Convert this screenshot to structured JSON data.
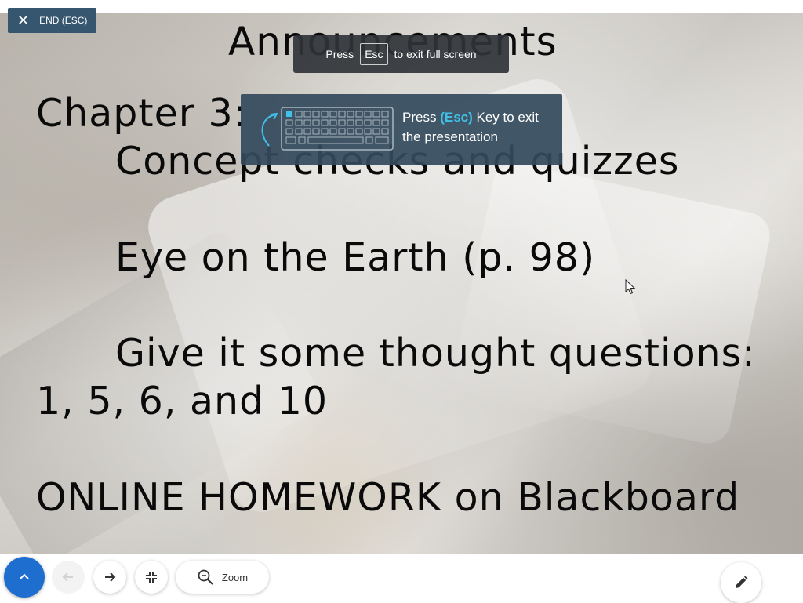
{
  "slide": {
    "title": "Announcements",
    "lines": [
      "Chapter 3:",
      "Concept checks and quizzes",
      "Eye on the Earth (p. 98)",
      "Give it some thought questions:",
      "1, 5, 6, and 10",
      "ONLINE HOMEWORK on Blackboard"
    ]
  },
  "end_button": {
    "label": "END (ESC)",
    "icon": "close-icon"
  },
  "fullscreen_toast": {
    "before": "Press",
    "key": "Esc",
    "after": "to exit full screen"
  },
  "esc_hint": {
    "before": "Press",
    "key": "(Esc)",
    "after": "Key to exit the presentation",
    "icon": "keyboard-icon"
  },
  "toolbar": {
    "toggle_icon": "chevron-up-icon",
    "prev_icon": "arrow-left-icon",
    "next_icon": "arrow-right-icon",
    "exit_fullscreen_icon": "exit-fullscreen-icon",
    "zoom_label": "Zoom",
    "zoom_icon": "zoom-out-icon",
    "pen_icon": "pencil-icon"
  },
  "colors": {
    "end_button_bg": "#36566f",
    "hint_bg": "#344a5c",
    "hint_key": "#3fc1e8",
    "toggle_bg": "#1e6ecf"
  }
}
